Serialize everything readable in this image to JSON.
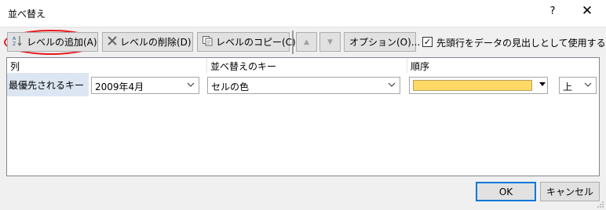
{
  "window": {
    "title": "並べ替え",
    "help_label": "?",
    "close_label": "✕"
  },
  "toolbar": {
    "add_level_label": "レベルの追加(A)",
    "delete_level_label": "レベルの削除(D)",
    "copy_level_label": "レベルのコピー(C)",
    "move_up_label": "▲",
    "move_down_label": "▼",
    "options_label": "オプション(O)...",
    "header_checkbox_label": "先頭行をデータの見出しとして使用する(H)",
    "header_checkbox_checked": true,
    "header_checkbox_mark": "✓"
  },
  "grid": {
    "headers": [
      "列",
      "並べ替えのキー",
      "順序"
    ],
    "rows": [
      {
        "label": "最優先されるキー",
        "column": "2009年4月",
        "sort_on": "セルの色",
        "color": "#ffd966",
        "order": "上"
      }
    ]
  },
  "footer": {
    "ok_label": "OK",
    "cancel_label": "キャンセル"
  },
  "icons": {
    "add": "sort-az-icon",
    "delete": "x-icon",
    "copy": "copy-icon",
    "dropdown": "chevron-down-icon"
  }
}
